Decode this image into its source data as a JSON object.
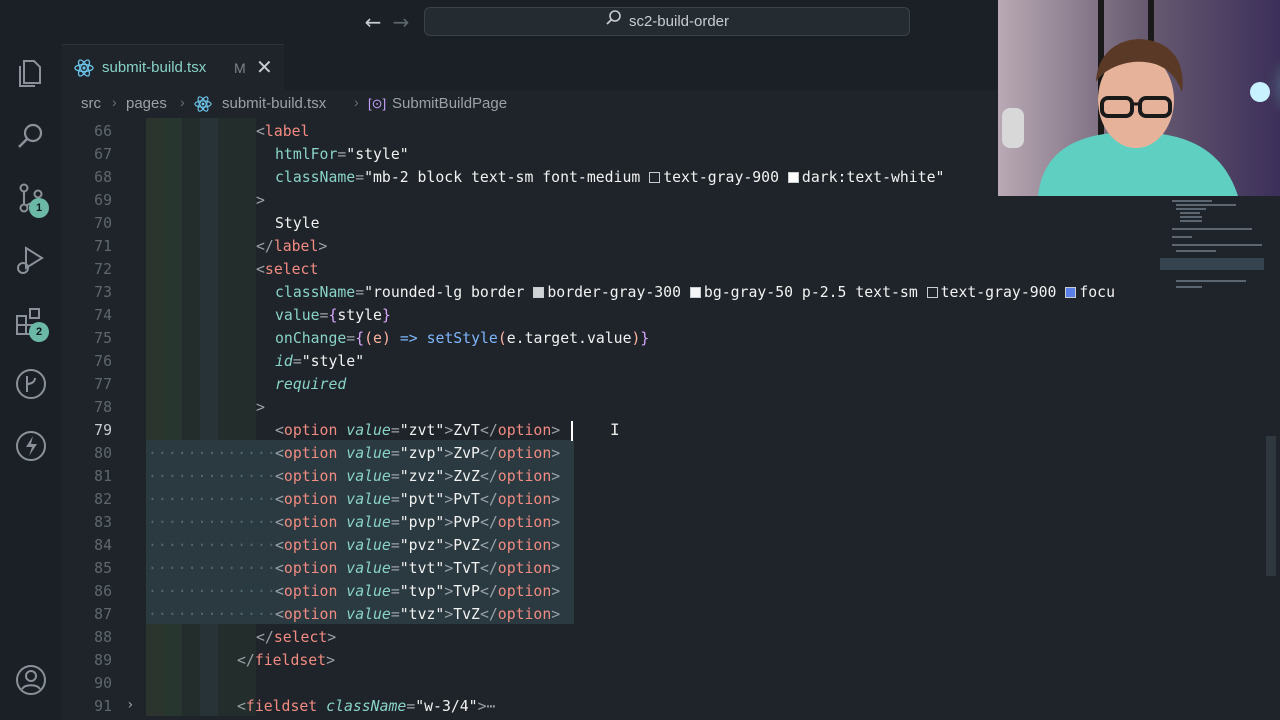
{
  "titlebar": {
    "back_icon": "arrow-left-icon",
    "forward_icon": "arrow-right-icon",
    "search_text": "sc2-build-order"
  },
  "activity": {
    "items": [
      {
        "name": "explorer-icon"
      },
      {
        "name": "search-icon"
      },
      {
        "name": "source-control-icon",
        "badge": "1"
      },
      {
        "name": "run-debug-icon"
      },
      {
        "name": "extensions-icon",
        "badge": "2"
      },
      {
        "name": "git-graph-icon"
      },
      {
        "name": "lightning-icon"
      },
      {
        "name": "account-icon"
      }
    ]
  },
  "tab": {
    "filename": "submit-build.tsx",
    "modified": "M",
    "close": "✕"
  },
  "breadcrumb": {
    "parts": [
      "src",
      "pages",
      "submit-build.tsx",
      "SubmitBuildPage"
    ]
  },
  "editor": {
    "line_numbers": [
      "66",
      "67",
      "68",
      "69",
      "70",
      "71",
      "72",
      "73",
      "74",
      "75",
      "76",
      "77",
      "78",
      "79",
      "80",
      "81",
      "82",
      "83",
      "84",
      "85",
      "86",
      "87",
      "88",
      "89",
      "90",
      "91"
    ],
    "active_line": "79",
    "label_open": "label",
    "htmlFor_attr": "htmlFor",
    "htmlFor_val": "\"style\"",
    "className_attr": "className",
    "label_class_a": "\"mb-2 block text-sm font-medium ",
    "label_class_b": "text-gray-900 ",
    "label_class_c": "dark:text-white\"",
    "gt": ">",
    "style_text": "Style",
    "label_close": "label",
    "select_open": "select",
    "select_class_a": "\"rounded-lg border ",
    "select_class_b": "border-gray-300 ",
    "select_class_c": "bg-gray-50 p-2.5 text-sm ",
    "select_class_d": "text-gray-900 ",
    "select_class_e": "focu",
    "value_attr": "value",
    "value_expr": "style",
    "onChange_attr": "onChange",
    "onChange_param": "e",
    "onChange_arrow": "=>",
    "onChange_fn": "setStyle",
    "onChange_arg": "e.target.value",
    "id_attr": "id",
    "id_val": "\"style\"",
    "required_attr": "required",
    "options": [
      {
        "value": "\"zvt\"",
        "label": "ZvT"
      },
      {
        "value": "\"zvp\"",
        "label": "ZvP"
      },
      {
        "value": "\"zvz\"",
        "label": "ZvZ"
      },
      {
        "value": "\"pvt\"",
        "label": "PvT"
      },
      {
        "value": "\"pvp\"",
        "label": "PvP"
      },
      {
        "value": "\"pvz\"",
        "label": "PvZ"
      },
      {
        "value": "\"tvt\"",
        "label": "TvT"
      },
      {
        "value": "\"tvp\"",
        "label": "TvP"
      },
      {
        "value": "\"tvz\"",
        "label": "TvZ"
      }
    ],
    "option_tag": "option",
    "select_close": "select",
    "fieldset_close": "fieldset",
    "fieldset_open": "fieldset",
    "fieldset_class": "\"w-3/4\"",
    "fold_ellipsis": "⋯",
    "dots": "·············"
  },
  "colors": {
    "tag": "#f28b82",
    "attribute": "#89d3c8",
    "string": "#f2f2f2",
    "badge": "#6bb8a6"
  }
}
